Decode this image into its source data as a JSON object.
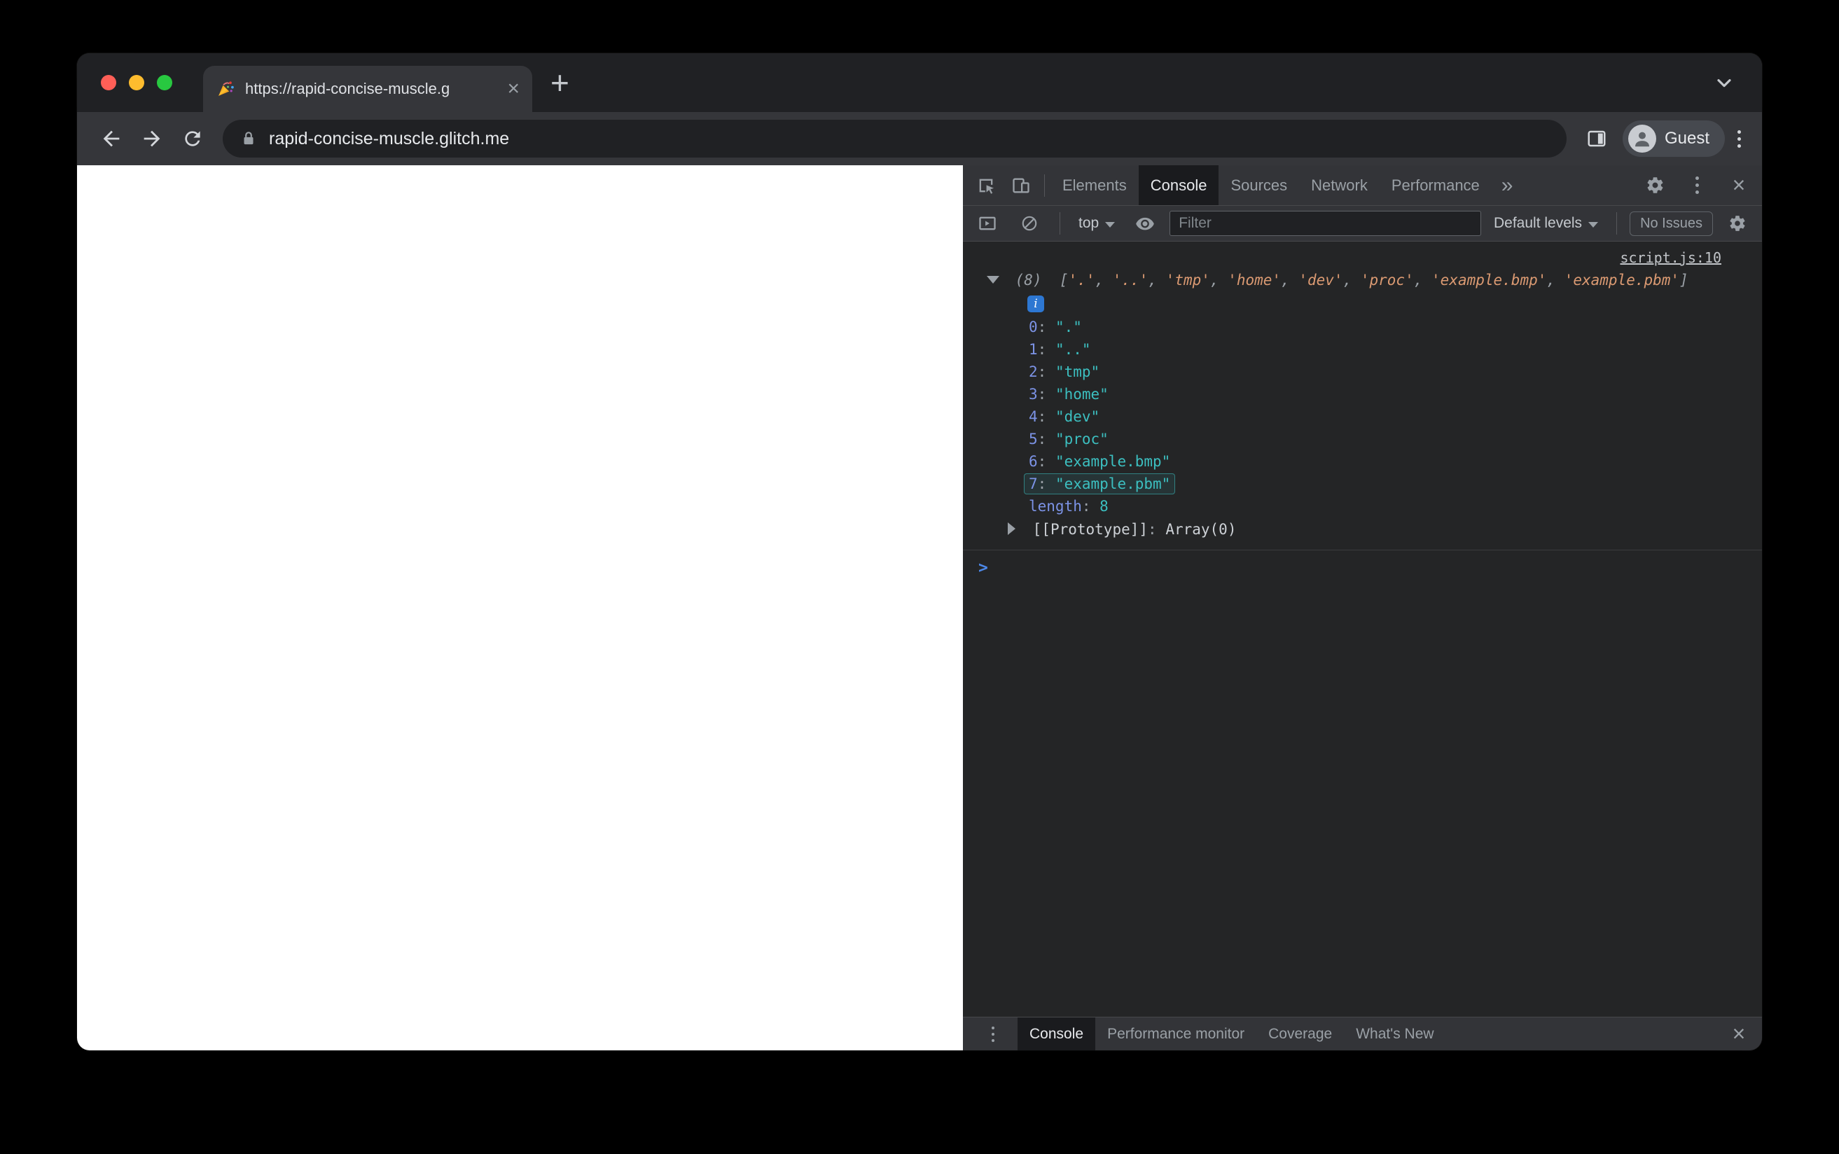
{
  "icons": {
    "close": "×",
    "new_tab": "+",
    "more_tabs": "»",
    "prompt": ">",
    "tab_favicon": "party-popper"
  },
  "browser": {
    "tab_title": "https://rapid-concise-muscle.g",
    "url": "rapid-concise-muscle.glitch.me",
    "profile_label": "Guest"
  },
  "devtools": {
    "main_tabs": {
      "elements": "Elements",
      "console": "Console",
      "sources": "Sources",
      "network": "Network",
      "performance": "Performance"
    },
    "toolbar": {
      "context_selector": "top",
      "filter_placeholder": "Filter",
      "levels_label": "Default levels",
      "issues_label": "No Issues"
    },
    "console": {
      "source_link": "script.js:10",
      "array_count": "(8)",
      "bracket_open": "[",
      "bracket_close": "]",
      "preview_items": [
        "'.'",
        "'..'",
        "'tmp'",
        "'home'",
        "'dev'",
        "'proc'",
        "'example.bmp'",
        "'example.pbm'"
      ],
      "entries": [
        {
          "key": "0",
          "value": "\".\""
        },
        {
          "key": "1",
          "value": "\"..\""
        },
        {
          "key": "2",
          "value": "\"tmp\""
        },
        {
          "key": "3",
          "value": "\"home\""
        },
        {
          "key": "4",
          "value": "\"dev\""
        },
        {
          "key": "5",
          "value": "\"proc\""
        },
        {
          "key": "6",
          "value": "\"example.bmp\""
        },
        {
          "key": "7",
          "value": "\"example.pbm\"",
          "highlighted": true
        }
      ],
      "length_key": "length",
      "length_value": "8",
      "colon": ": ",
      "prototype_key": "[[Prototype]]",
      "prototype_value": "Array(0)"
    },
    "drawer_tabs": {
      "console": "Console",
      "performance_monitor": "Performance monitor",
      "coverage": "Coverage",
      "whats_new": "What's New"
    }
  }
}
